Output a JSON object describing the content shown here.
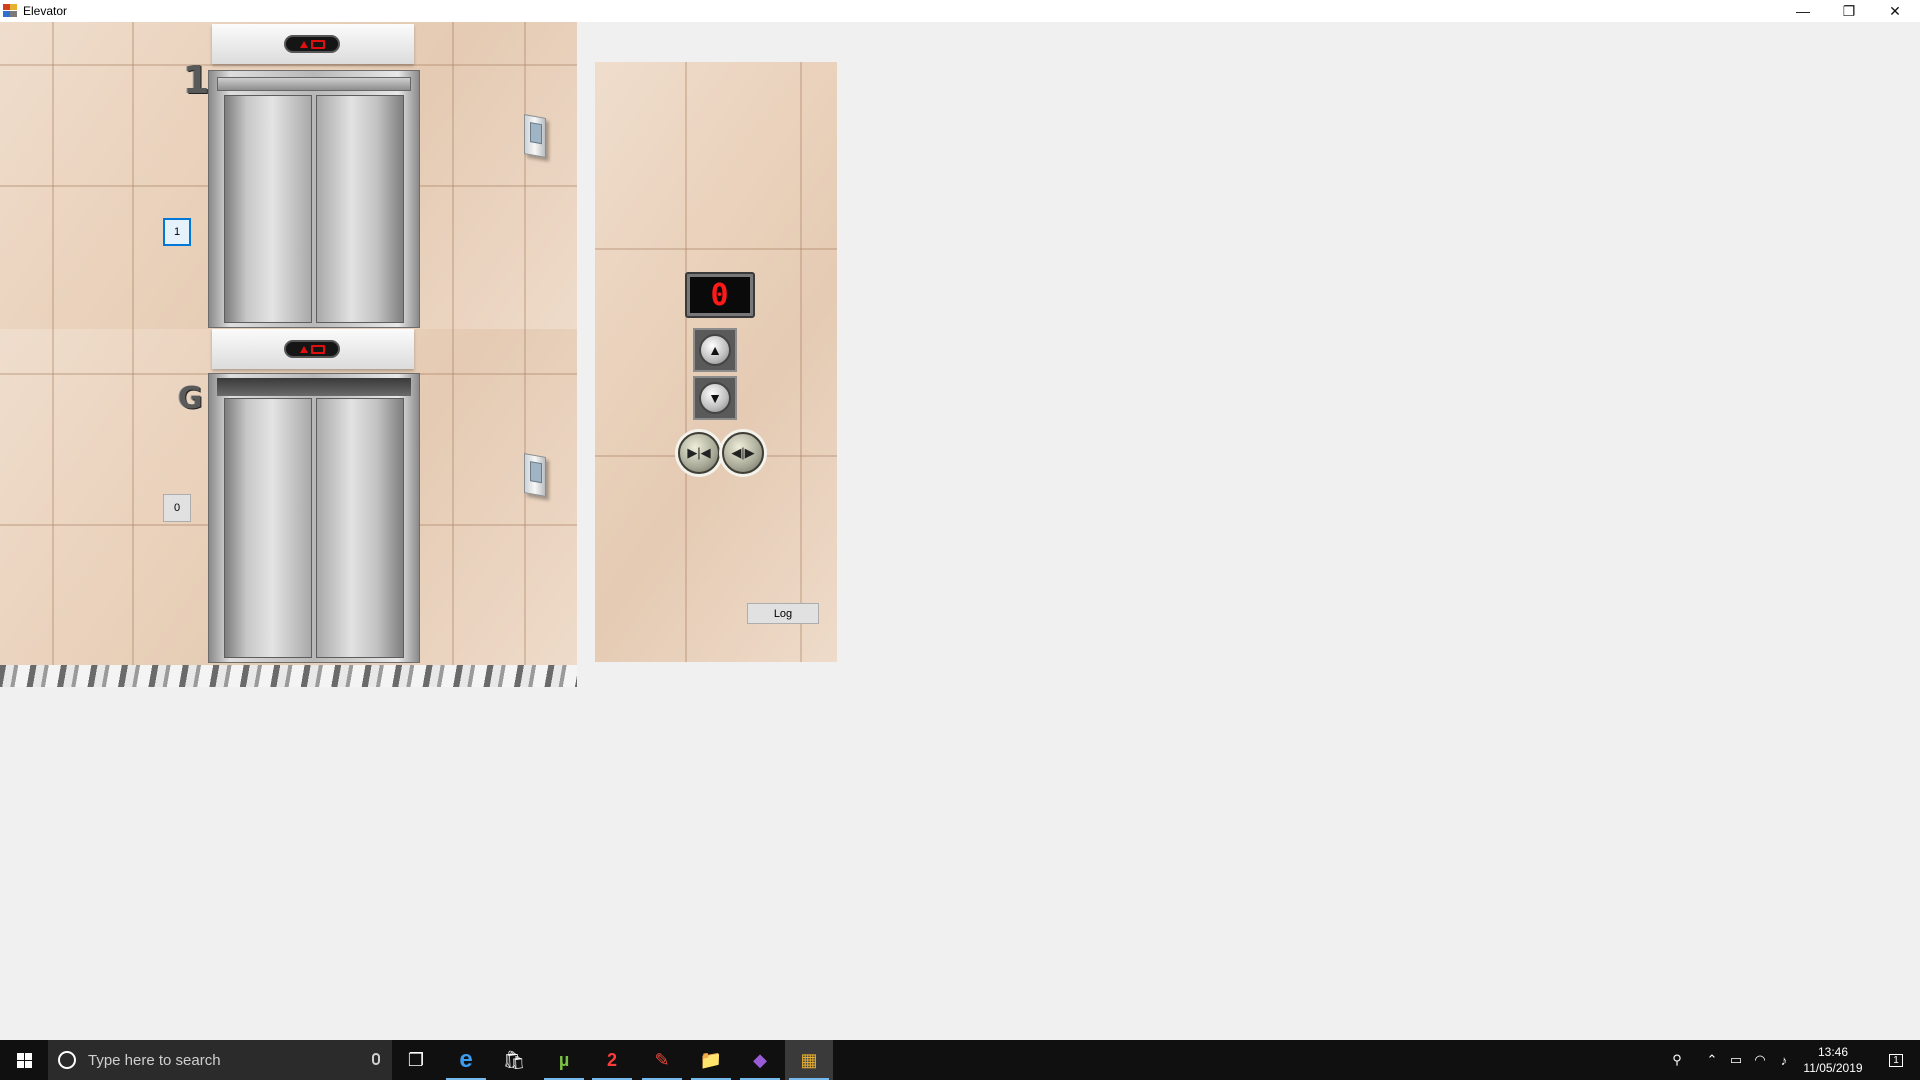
{
  "window": {
    "title": "Elevator",
    "minimize_glyph": "—",
    "restore_glyph": "❐",
    "close_glyph": "✕"
  },
  "floors": [
    {
      "id": "floor-1",
      "wall_label": "1",
      "button_label": "1",
      "button_focused": true,
      "doors": "closed"
    },
    {
      "id": "floor-0",
      "wall_label": "G",
      "button_label": "0",
      "button_focused": false,
      "doors": "opening"
    }
  ],
  "control_panel": {
    "display_value": "0",
    "up_icon": "up-arrow-icon",
    "down_icon": "down-arrow-icon",
    "open_icon": "door-open-icon",
    "close_icon": "door-close-icon",
    "up_glyph": "▲",
    "down_glyph": "▼",
    "close_glyph": "▶|◀",
    "open_glyph": "◀|▶",
    "log_label": "Log"
  },
  "taskbar": {
    "search_placeholder": "Type here to search",
    "apps": [
      {
        "name": "task-view-icon",
        "glyph": "❐"
      },
      {
        "name": "edge-icon",
        "glyph": "e"
      },
      {
        "name": "store-icon",
        "glyph": "🛍"
      },
      {
        "name": "utorrent-icon",
        "glyph": "µ"
      },
      {
        "name": "app-red-icon",
        "glyph": "2"
      },
      {
        "name": "app-acrobat-icon",
        "glyph": "✎"
      },
      {
        "name": "file-explorer-icon",
        "glyph": "📁"
      },
      {
        "name": "visual-studio-icon",
        "glyph": "◆"
      },
      {
        "name": "elevator-app-icon",
        "glyph": "▦"
      }
    ],
    "time": "13:46",
    "date": "11/05/2019",
    "notification_count": "1"
  },
  "colors": {
    "accent": "#0078d7",
    "display_red": "#ff1a1a",
    "taskbar_bg": "#101010"
  }
}
